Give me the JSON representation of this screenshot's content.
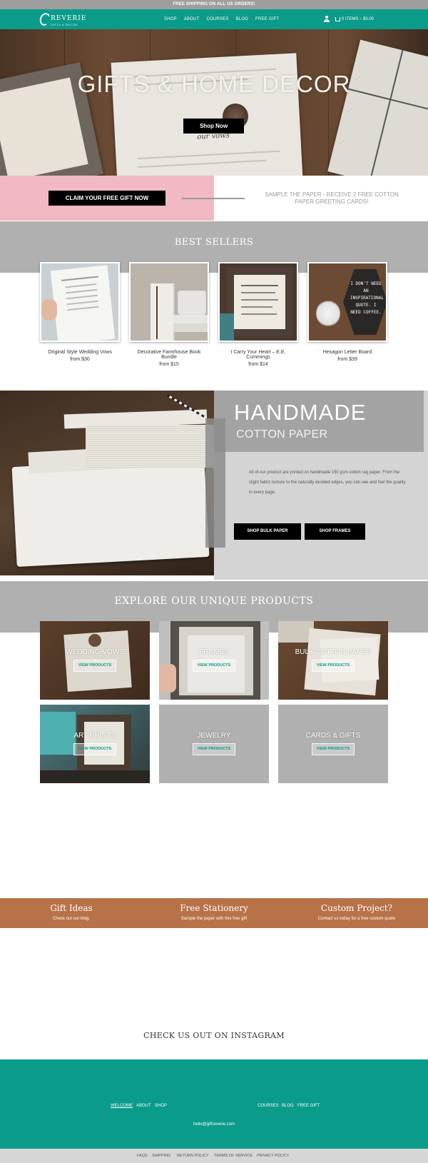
{
  "announcement": "FREE SHIPPING ON ALL US ORDERS!",
  "header": {
    "logo_name": "REVERIE",
    "logo_tag": "GIFTS & DECOR",
    "nav": [
      "SHOP",
      "ABOUT",
      "COURSES",
      "BLOG",
      "FREE GIFT"
    ],
    "cart_text": "0 ITEMS – $0.00"
  },
  "hero": {
    "title": "GIFTS & HOME DECOR",
    "button": "Shop Now",
    "paper_text": "our vows"
  },
  "gift": {
    "button": "CLAIM YOUR FREE GIFT NOW",
    "text": "SAMPLE THE PAPER - RECEIVE 2 FREE COTTON PAPER GREETING CARDS!"
  },
  "best_sellers": {
    "title": "BEST SELLERS",
    "products": [
      {
        "name": "Original Style Wedding Vows",
        "price": "from $30"
      },
      {
        "name": "Decorative Farmhouse Book Bundle",
        "price": "from $15"
      },
      {
        "name": "I Carry Your Heart – E.E. Cummings",
        "price": "from $14"
      },
      {
        "name": "Hexagon Letter Board",
        "price": "from $39",
        "board_text": "I DON'T NEED AN INSPIRATIONAL QUOTE. I NEED COFFEE."
      }
    ]
  },
  "handmade": {
    "title": "HANDMADE",
    "subtitle": "COTTON PAPER",
    "description": "All of our product are printed on handmade 150 gsm cotton rag paper. From the slight fabric texture to the naturally deckled edges, you can see and feel the quality in every page.",
    "button_bulk": "SHOP BULK PAPER",
    "button_frames": "SHOP FRAMES"
  },
  "explore": {
    "title": "EXPLORE OUR UNIQUE PRODUCTS",
    "button": "VIEW PRODUCTS",
    "tiles": [
      "WEDDING VOWS",
      "FRAMES",
      "BULK COTTON PAPER",
      "ART PRINTS",
      "JEWELRY",
      "CARDS & GIFTS"
    ]
  },
  "promo": [
    {
      "title": "Gift Ideas",
      "sub": "Check out our blog."
    },
    {
      "title": "Free Stationery",
      "sub": "Sample the paper with this free gift"
    },
    {
      "title": "Custom Project?",
      "sub": "Contact us today for a free custom quote"
    }
  ],
  "instagram_title": "CHECK US OUT ON INSTAGRAM",
  "footer": {
    "links_left": [
      "WELCOME",
      "ABOUT",
      "SHOP"
    ],
    "links_right": [
      "COURSES",
      "BLOG",
      "FREE GIFT"
    ],
    "email": "hello@giftreverie.com"
  },
  "bottom_links": [
    "FAQS",
    "SHIPPING",
    "RETURN POLICY",
    "TERMS OF SERVICE",
    "PRIVACY POLICY"
  ],
  "colors": {
    "teal": "#0a9b8b",
    "pink": "#f0b9c4",
    "orange": "#b87248",
    "gray_band": "#b0b0b0"
  }
}
